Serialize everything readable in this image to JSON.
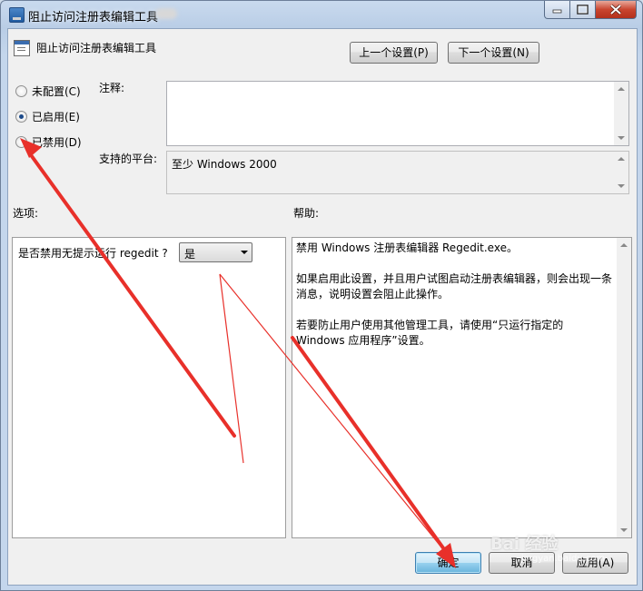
{
  "window": {
    "title": "阻止访问注册表编辑工具"
  },
  "header": {
    "policy_name": "阻止访问注册表编辑工具",
    "prev_label": "上一个设置(P)",
    "next_label": "下一个设置(N)"
  },
  "state": {
    "options": [
      {
        "label": "未配置(C)",
        "selected": false
      },
      {
        "label": "已启用(E)",
        "selected": true
      },
      {
        "label": "已禁用(D)",
        "selected": false
      }
    ]
  },
  "comment": {
    "label": "注释:",
    "value": ""
  },
  "platform": {
    "label": "支持的平台:",
    "value": "至少 Windows 2000"
  },
  "options_section": {
    "label": "选项:",
    "question": "是否禁用无提示运行 regedit ?",
    "selected": "是"
  },
  "help_section": {
    "label": "帮助:",
    "paragraphs": [
      "禁用 Windows 注册表编辑器 Regedit.exe。",
      "如果启用此设置，并且用户试图启动注册表编辑器，则会出现一条消息，说明设置会阻止此操作。",
      "若要防止用户使用其他管理工具，请使用“只运行指定的 Windows 应用程序”设置。"
    ]
  },
  "footer": {
    "ok_label": "确定",
    "cancel_label": "取消",
    "apply_label": "应用(A)"
  },
  "watermark": {
    "text": "Bai 经验",
    "sub": "jingyan.baidu.com"
  },
  "colors": {
    "annotation_arrow": "#e8302a",
    "selected_radio": "#1c4a8a"
  }
}
